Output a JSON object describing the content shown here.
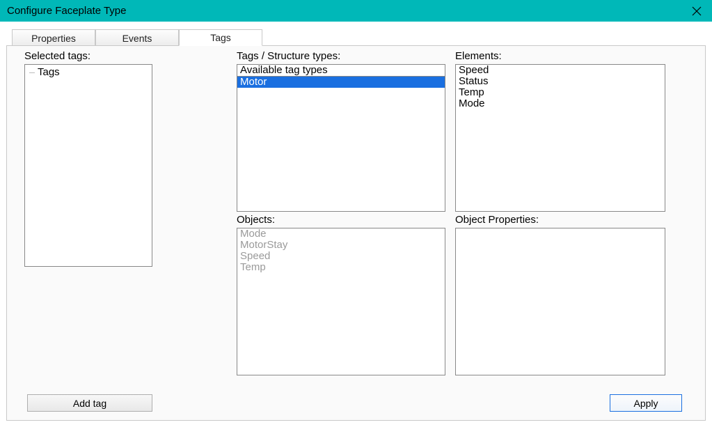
{
  "title": "Configure Faceplate Type",
  "tabs": [
    {
      "label": "Properties",
      "active": false
    },
    {
      "label": "Events",
      "active": false
    },
    {
      "label": "Tags",
      "active": true
    }
  ],
  "labels": {
    "selected_tags": "Selected tags:",
    "tag_types": "Tags / Structure types:",
    "elements": "Elements:",
    "objects": "Objects:",
    "object_properties": "Object Properties:"
  },
  "selected_tags_tree": [
    "Tags"
  ],
  "tag_types": {
    "header": "Available tag types",
    "items": [
      {
        "text": "Motor",
        "selected": true
      }
    ]
  },
  "elements": [
    "Speed",
    "Status",
    "Temp",
    "Mode"
  ],
  "objects": [
    "Mode",
    "MotorStay",
    "Speed",
    "Temp"
  ],
  "object_properties": [],
  "buttons": {
    "add_tag": "Add tag",
    "apply": "Apply"
  },
  "colors": {
    "titlebar": "#00b8b8",
    "selection": "#1a6fe0"
  }
}
